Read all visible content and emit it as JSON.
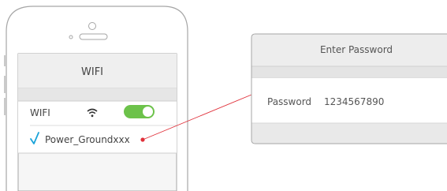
{
  "phone": {
    "header_title": "WIFI",
    "wifi_row": {
      "label": "WIFI",
      "icon": "wifi-icon",
      "toggle_on": true,
      "toggle_color": "#6cc24a"
    },
    "network": {
      "check_icon": "checkmark-icon",
      "name": "Power_Groundxxx",
      "check_color": "#1aa3d9"
    }
  },
  "password_dialog": {
    "title": "Enter Password",
    "field_label": "Password",
    "field_value": "1234567890"
  },
  "connector": {
    "color": "#e0303a"
  }
}
